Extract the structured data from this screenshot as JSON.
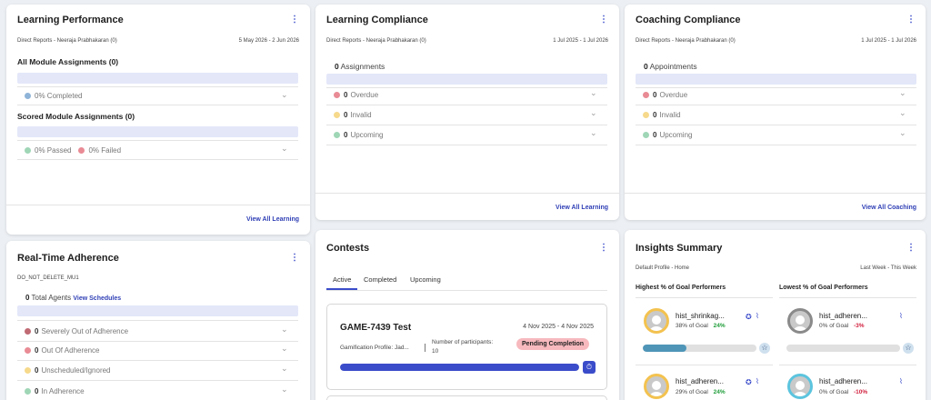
{
  "learning_performance": {
    "title": "Learning Performance",
    "reports_label": "Direct Reports - Neeraja Prabhakaran (0)",
    "date_range": "5 May 2026 - 2 Jun 2026",
    "all_module_heading": "All Module Assignments (0)",
    "completed_label": "0% Completed",
    "scored_heading": "Scored Module Assignments (0)",
    "passed_label": "0% Passed",
    "failed_label": "0% Failed",
    "view_all": "View All Learning"
  },
  "learning_compliance": {
    "title": "Learning Compliance",
    "reports_label": "Direct Reports - Neeraja Prabhakaran (0)",
    "date_range": "1 Jul 2025 - 1 Jul 2026",
    "count": "0",
    "count_label": "Assignments",
    "rows": [
      {
        "num": "0",
        "label": "Overdue"
      },
      {
        "num": "0",
        "label": "Invalid"
      },
      {
        "num": "0",
        "label": "Upcoming"
      }
    ],
    "view_all": "View All Learning"
  },
  "coaching_compliance": {
    "title": "Coaching Compliance",
    "reports_label": "Direct Reports - Neeraja Prabhakaran (0)",
    "date_range": "1 Jul 2025 - 1 Jul 2026",
    "count": "0",
    "count_label": "Appointments",
    "rows": [
      {
        "num": "0",
        "label": "Overdue"
      },
      {
        "num": "0",
        "label": "Invalid"
      },
      {
        "num": "0",
        "label": "Upcoming"
      }
    ],
    "view_all": "View All Coaching"
  },
  "adherence": {
    "title": "Real-Time Adherence",
    "group": "DO_NOT_DELETE_MU1",
    "total_num": "0",
    "total_label": "Total Agents",
    "view_schedules": "View Schedules",
    "rows": [
      {
        "num": "0",
        "label": "Severely Out of Adherence"
      },
      {
        "num": "0",
        "label": "Out Of Adherence"
      },
      {
        "num": "0",
        "label": "Unscheduled/Ignored"
      },
      {
        "num": "0",
        "label": "In Adherence"
      }
    ]
  },
  "contests": {
    "title": "Contests",
    "tabs": [
      "Active",
      "Completed",
      "Upcoming"
    ],
    "contest": {
      "name": "GAME-7439 Test",
      "dates": "4 Nov 2025 - 4 Nov 2025",
      "profile": "Gamification Profile: Jad...",
      "participants_label": "Number of participants:",
      "participants_value": "10",
      "status": "Pending Completion",
      "progress": 1.0
    }
  },
  "insights": {
    "title": "Insights Summary",
    "profile": "Default Profile - Home",
    "period": "Last Week - This Week",
    "highest_heading": "Highest % of Goal Performers",
    "lowest_heading": "Lowest % of Goal Performers",
    "highest": [
      {
        "name": "hist_shrinkag...",
        "goal": "38% of Goal",
        "delta": "24%",
        "progress": 0.38
      },
      {
        "name": "hist_adheren...",
        "goal": "29% of Goal",
        "delta": "24%"
      }
    ],
    "lowest": [
      {
        "name": "hist_adheren...",
        "goal": "0% of Goal",
        "delta": "-3%",
        "progress": 0.0
      },
      {
        "name": "hist_adheren...",
        "goal": "0% of Goal",
        "delta": "-10%"
      }
    ]
  },
  "colors": {
    "accent": "#3b4cca",
    "blue_dot": "#8fb4d8",
    "green_dot": "#9fd6b6",
    "red_dot": "#e98b95",
    "yellow_dot": "#f6d98b",
    "dark_red_dot": "#c06a74",
    "badge": "#f7b9be",
    "goal_fill": "#4e95b8"
  },
  "icons": {
    "kebab": "more-vertical-icon",
    "chevron": "chevron-down-icon",
    "timer": "timer-icon",
    "award": "award-icon",
    "chart": "chart-icon",
    "star": "star-icon"
  }
}
